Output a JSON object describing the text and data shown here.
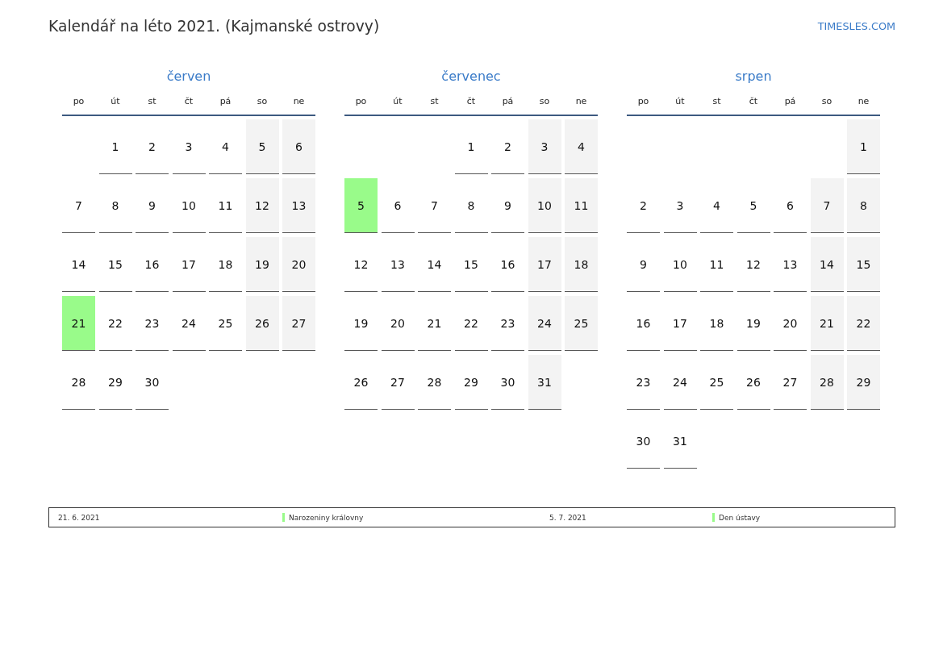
{
  "title": "Kalendář na léto 2021. (Kajmanské ostrovy)",
  "site": "TIMESLES.COM",
  "months": [
    {
      "name": "červen",
      "weekdays": [
        "po",
        "út",
        "st",
        "čt",
        "pá",
        "so",
        "ne"
      ],
      "weeks": [
        [
          {
            "kind": "blank"
          },
          {
            "kind": "day",
            "day": "1",
            "weekend": false,
            "holiday": false
          },
          {
            "kind": "day",
            "day": "2",
            "weekend": false,
            "holiday": false
          },
          {
            "kind": "day",
            "day": "3",
            "weekend": false,
            "holiday": false
          },
          {
            "kind": "day",
            "day": "4",
            "weekend": false,
            "holiday": false
          },
          {
            "kind": "day",
            "day": "5",
            "weekend": true,
            "holiday": false
          },
          {
            "kind": "day",
            "day": "6",
            "weekend": true,
            "holiday": false
          }
        ],
        [
          {
            "kind": "day",
            "day": "7",
            "weekend": false,
            "holiday": false
          },
          {
            "kind": "day",
            "day": "8",
            "weekend": false,
            "holiday": false
          },
          {
            "kind": "day",
            "day": "9",
            "weekend": false,
            "holiday": false
          },
          {
            "kind": "day",
            "day": "10",
            "weekend": false,
            "holiday": false
          },
          {
            "kind": "day",
            "day": "11",
            "weekend": false,
            "holiday": false
          },
          {
            "kind": "day",
            "day": "12",
            "weekend": true,
            "holiday": false
          },
          {
            "kind": "day",
            "day": "13",
            "weekend": true,
            "holiday": false
          }
        ],
        [
          {
            "kind": "day",
            "day": "14",
            "weekend": false,
            "holiday": false
          },
          {
            "kind": "day",
            "day": "15",
            "weekend": false,
            "holiday": false
          },
          {
            "kind": "day",
            "day": "16",
            "weekend": false,
            "holiday": false
          },
          {
            "kind": "day",
            "day": "17",
            "weekend": false,
            "holiday": false
          },
          {
            "kind": "day",
            "day": "18",
            "weekend": false,
            "holiday": false
          },
          {
            "kind": "day",
            "day": "19",
            "weekend": true,
            "holiday": false
          },
          {
            "kind": "day",
            "day": "20",
            "weekend": true,
            "holiday": false
          }
        ],
        [
          {
            "kind": "day",
            "day": "21",
            "weekend": false,
            "holiday": true
          },
          {
            "kind": "day",
            "day": "22",
            "weekend": false,
            "holiday": false
          },
          {
            "kind": "day",
            "day": "23",
            "weekend": false,
            "holiday": false
          },
          {
            "kind": "day",
            "day": "24",
            "weekend": false,
            "holiday": false
          },
          {
            "kind": "day",
            "day": "25",
            "weekend": false,
            "holiday": false
          },
          {
            "kind": "day",
            "day": "26",
            "weekend": true,
            "holiday": false
          },
          {
            "kind": "day",
            "day": "27",
            "weekend": true,
            "holiday": false
          }
        ],
        [
          {
            "kind": "day",
            "day": "28",
            "weekend": false,
            "holiday": false
          },
          {
            "kind": "day",
            "day": "29",
            "weekend": false,
            "holiday": false
          },
          {
            "kind": "day",
            "day": "30",
            "weekend": false,
            "holiday": false
          }
        ]
      ]
    },
    {
      "name": "červenec",
      "weekdays": [
        "po",
        "út",
        "st",
        "čt",
        "pá",
        "so",
        "ne"
      ],
      "weeks": [
        [
          {
            "kind": "blank"
          },
          {
            "kind": "blank"
          },
          {
            "kind": "blank"
          },
          {
            "kind": "day",
            "day": "1",
            "weekend": false,
            "holiday": false
          },
          {
            "kind": "day",
            "day": "2",
            "weekend": false,
            "holiday": false
          },
          {
            "kind": "day",
            "day": "3",
            "weekend": true,
            "holiday": false
          },
          {
            "kind": "day",
            "day": "4",
            "weekend": true,
            "holiday": false
          }
        ],
        [
          {
            "kind": "day",
            "day": "5",
            "weekend": false,
            "holiday": true
          },
          {
            "kind": "day",
            "day": "6",
            "weekend": false,
            "holiday": false
          },
          {
            "kind": "day",
            "day": "7",
            "weekend": false,
            "holiday": false
          },
          {
            "kind": "day",
            "day": "8",
            "weekend": false,
            "holiday": false
          },
          {
            "kind": "day",
            "day": "9",
            "weekend": false,
            "holiday": false
          },
          {
            "kind": "day",
            "day": "10",
            "weekend": true,
            "holiday": false
          },
          {
            "kind": "day",
            "day": "11",
            "weekend": true,
            "holiday": false
          }
        ],
        [
          {
            "kind": "day",
            "day": "12",
            "weekend": false,
            "holiday": false
          },
          {
            "kind": "day",
            "day": "13",
            "weekend": false,
            "holiday": false
          },
          {
            "kind": "day",
            "day": "14",
            "weekend": false,
            "holiday": false
          },
          {
            "kind": "day",
            "day": "15",
            "weekend": false,
            "holiday": false
          },
          {
            "kind": "day",
            "day": "16",
            "weekend": false,
            "holiday": false
          },
          {
            "kind": "day",
            "day": "17",
            "weekend": true,
            "holiday": false
          },
          {
            "kind": "day",
            "day": "18",
            "weekend": true,
            "holiday": false
          }
        ],
        [
          {
            "kind": "day",
            "day": "19",
            "weekend": false,
            "holiday": false
          },
          {
            "kind": "day",
            "day": "20",
            "weekend": false,
            "holiday": false
          },
          {
            "kind": "day",
            "day": "21",
            "weekend": false,
            "holiday": false
          },
          {
            "kind": "day",
            "day": "22",
            "weekend": false,
            "holiday": false
          },
          {
            "kind": "day",
            "day": "23",
            "weekend": false,
            "holiday": false
          },
          {
            "kind": "day",
            "day": "24",
            "weekend": true,
            "holiday": false
          },
          {
            "kind": "day",
            "day": "25",
            "weekend": true,
            "holiday": false
          }
        ],
        [
          {
            "kind": "day",
            "day": "26",
            "weekend": false,
            "holiday": false
          },
          {
            "kind": "day",
            "day": "27",
            "weekend": false,
            "holiday": false
          },
          {
            "kind": "day",
            "day": "28",
            "weekend": false,
            "holiday": false
          },
          {
            "kind": "day",
            "day": "29",
            "weekend": false,
            "holiday": false
          },
          {
            "kind": "day",
            "day": "30",
            "weekend": false,
            "holiday": false
          },
          {
            "kind": "day",
            "day": "31",
            "weekend": true,
            "holiday": false
          }
        ]
      ]
    },
    {
      "name": "srpen",
      "weekdays": [
        "po",
        "út",
        "st",
        "čt",
        "pá",
        "so",
        "ne"
      ],
      "weeks": [
        [
          {
            "kind": "blank"
          },
          {
            "kind": "blank"
          },
          {
            "kind": "blank"
          },
          {
            "kind": "blank"
          },
          {
            "kind": "blank"
          },
          {
            "kind": "blank"
          },
          {
            "kind": "day",
            "day": "1",
            "weekend": true,
            "holiday": false
          }
        ],
        [
          {
            "kind": "day",
            "day": "2",
            "weekend": false,
            "holiday": false
          },
          {
            "kind": "day",
            "day": "3",
            "weekend": false,
            "holiday": false
          },
          {
            "kind": "day",
            "day": "4",
            "weekend": false,
            "holiday": false
          },
          {
            "kind": "day",
            "day": "5",
            "weekend": false,
            "holiday": false
          },
          {
            "kind": "day",
            "day": "6",
            "weekend": false,
            "holiday": false
          },
          {
            "kind": "day",
            "day": "7",
            "weekend": true,
            "holiday": false
          },
          {
            "kind": "day",
            "day": "8",
            "weekend": true,
            "holiday": false
          }
        ],
        [
          {
            "kind": "day",
            "day": "9",
            "weekend": false,
            "holiday": false
          },
          {
            "kind": "day",
            "day": "10",
            "weekend": false,
            "holiday": false
          },
          {
            "kind": "day",
            "day": "11",
            "weekend": false,
            "holiday": false
          },
          {
            "kind": "day",
            "day": "12",
            "weekend": false,
            "holiday": false
          },
          {
            "kind": "day",
            "day": "13",
            "weekend": false,
            "holiday": false
          },
          {
            "kind": "day",
            "day": "14",
            "weekend": true,
            "holiday": false
          },
          {
            "kind": "day",
            "day": "15",
            "weekend": true,
            "holiday": false
          }
        ],
        [
          {
            "kind": "day",
            "day": "16",
            "weekend": false,
            "holiday": false
          },
          {
            "kind": "day",
            "day": "17",
            "weekend": false,
            "holiday": false
          },
          {
            "kind": "day",
            "day": "18",
            "weekend": false,
            "holiday": false
          },
          {
            "kind": "day",
            "day": "19",
            "weekend": false,
            "holiday": false
          },
          {
            "kind": "day",
            "day": "20",
            "weekend": false,
            "holiday": false
          },
          {
            "kind": "day",
            "day": "21",
            "weekend": true,
            "holiday": false
          },
          {
            "kind": "day",
            "day": "22",
            "weekend": true,
            "holiday": false
          }
        ],
        [
          {
            "kind": "day",
            "day": "23",
            "weekend": false,
            "holiday": false
          },
          {
            "kind": "day",
            "day": "24",
            "weekend": false,
            "holiday": false
          },
          {
            "kind": "day",
            "day": "25",
            "weekend": false,
            "holiday": false
          },
          {
            "kind": "day",
            "day": "26",
            "weekend": false,
            "holiday": false
          },
          {
            "kind": "day",
            "day": "27",
            "weekend": false,
            "holiday": false
          },
          {
            "kind": "day",
            "day": "28",
            "weekend": true,
            "holiday": false
          },
          {
            "kind": "day",
            "day": "29",
            "weekend": true,
            "holiday": false
          }
        ],
        [
          {
            "kind": "day",
            "day": "30",
            "weekend": false,
            "holiday": false
          },
          {
            "kind": "day",
            "day": "31",
            "weekend": false,
            "holiday": false
          }
        ]
      ]
    }
  ],
  "holidays": [
    {
      "date": "21. 6. 2021",
      "name": "Narozeniny královny"
    },
    {
      "date": "5. 7. 2021",
      "name": "Den ústavy"
    }
  ]
}
